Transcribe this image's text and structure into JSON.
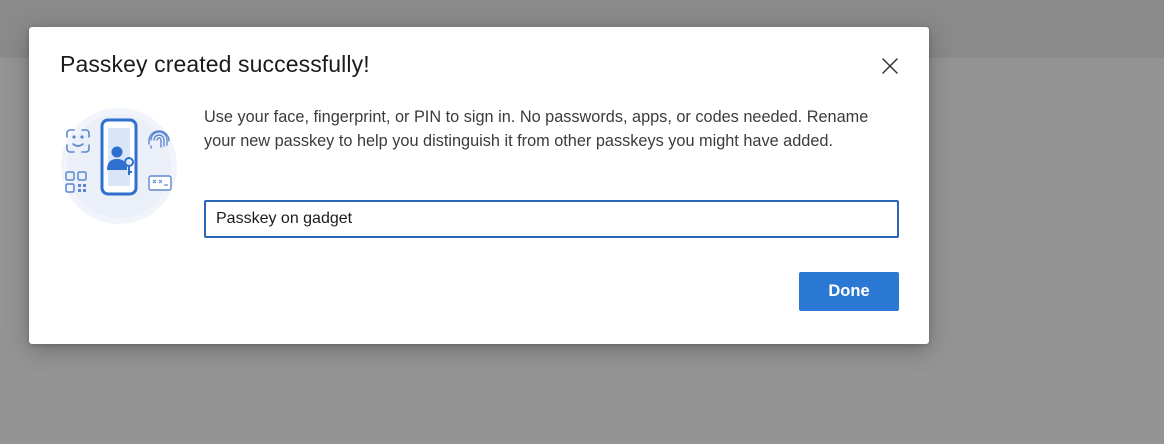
{
  "dialog": {
    "title": "Passkey created successfully!",
    "description": "Use your face, fingerprint, or PIN to sign in. No passwords, apps, or codes needed. Rename your new passkey to help you distinguish it from other passkeys you might have added.",
    "name_input_value": "Passkey on gadget",
    "done_label": "Done",
    "close_icon": "close-icon",
    "illustration_icons": [
      "face-scan-icon",
      "phone-user-key-icon",
      "fingerprint-icon",
      "qr-code-icon",
      "pin-code-icon"
    ]
  },
  "colors": {
    "accent": "#2b78d4",
    "input_border": "#2b64b8",
    "backdrop": "#8f8f8f"
  }
}
